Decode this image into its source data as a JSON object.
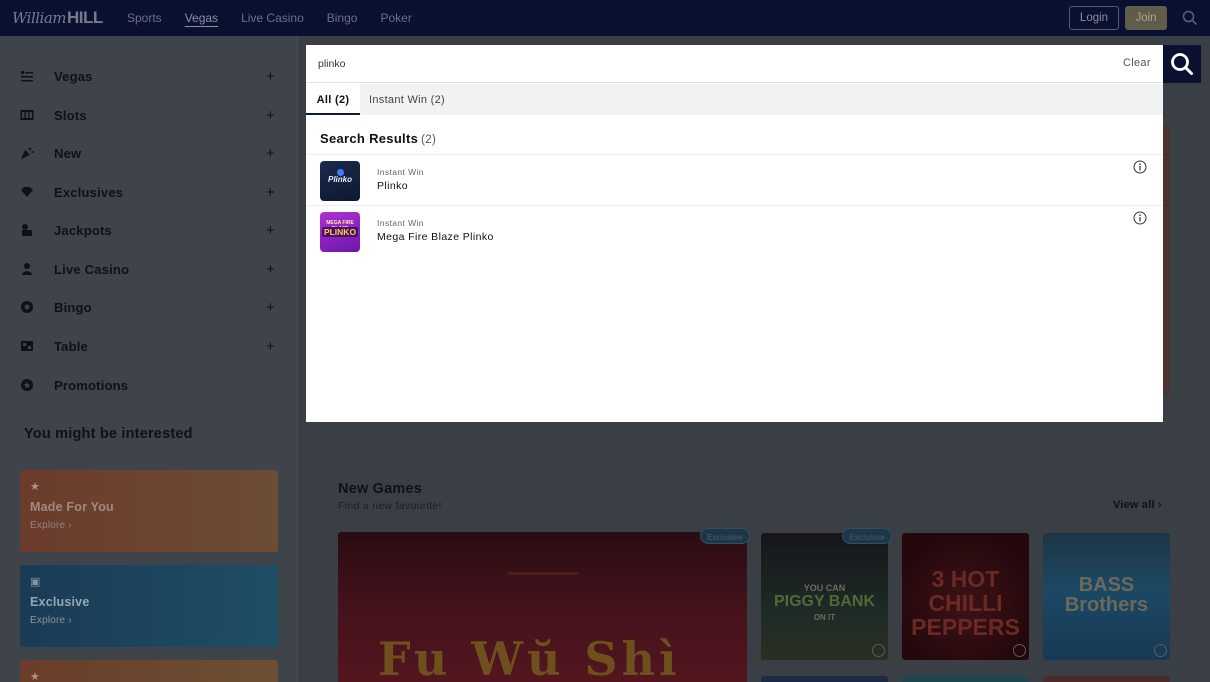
{
  "brand": {
    "logo_script": "William",
    "logo_bold": "HILL"
  },
  "nav": [
    {
      "label": "Sports",
      "active": false
    },
    {
      "label": "Vegas",
      "active": true
    },
    {
      "label": "Live Casino",
      "active": false
    },
    {
      "label": "Bingo",
      "active": false
    },
    {
      "label": "Poker",
      "active": false
    }
  ],
  "header": {
    "login_label": "Login",
    "join_label": "Join",
    "search_icon": "search-icon"
  },
  "sidebar": {
    "items": [
      {
        "label": "Vegas",
        "icon": "vegas-icon",
        "expandable": true
      },
      {
        "label": "Slots",
        "icon": "slots-icon",
        "expandable": true
      },
      {
        "label": "New",
        "icon": "new-icon",
        "expandable": true
      },
      {
        "label": "Exclusives",
        "icon": "diamond-icon",
        "expandable": true
      },
      {
        "label": "Jackpots",
        "icon": "jackpot-icon",
        "expandable": true
      },
      {
        "label": "Live Casino",
        "icon": "live-casino-icon",
        "expandable": true
      },
      {
        "label": "Bingo",
        "icon": "bingo-icon",
        "expandable": true
      },
      {
        "label": "Table",
        "icon": "table-icon",
        "expandable": true
      },
      {
        "label": "Promotions",
        "icon": "promotions-icon",
        "expandable": false
      }
    ],
    "plus": "+",
    "interest_title": "You might be interested",
    "cards": [
      {
        "title": "Made For You",
        "explore": "Explore ›",
        "icon": "star-icon"
      },
      {
        "title": "Exclusive",
        "explore": "Explore ›",
        "icon": "exclusive-icon"
      }
    ]
  },
  "main": {
    "section_title": "New Games",
    "section_subtitle": "Find a new favourite!",
    "view_all": "View all ›",
    "games": [
      {
        "title": "Fu Wŭ Shì"
      },
      {
        "title_line1": "YOU CAN",
        "title_line2": "PIGGY BANK",
        "title_line3": "ON IT",
        "badge": "Exclusive"
      },
      {
        "title": "3 HOT CHILLI PEPPERS"
      },
      {
        "title": "BASS Brothers"
      }
    ],
    "big_badge": "Exclusive"
  },
  "search": {
    "query": "plinko",
    "clear_label": "Clear",
    "tabs": [
      {
        "label": "All (2)",
        "active": true
      },
      {
        "label": "Instant Win (2)",
        "active": false
      }
    ],
    "results_title": "Search Results",
    "results_count": "(2)",
    "results": [
      {
        "category": "Instant Win",
        "name": "Plinko",
        "thumb_text": "Plinko"
      },
      {
        "category": "Instant Win",
        "name": "Mega Fire Blaze Plinko",
        "thumb_text": "PLINKO",
        "thumb_subtext": "MEGA FIRE BLAZE"
      }
    ]
  }
}
